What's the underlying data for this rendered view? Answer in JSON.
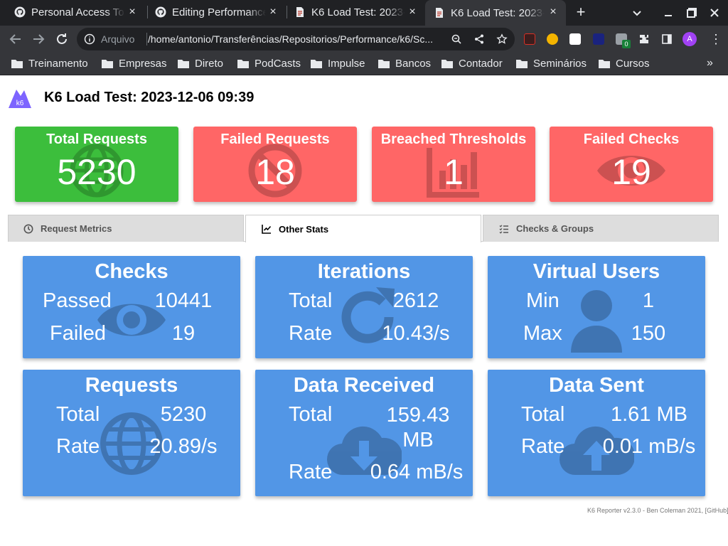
{
  "browser": {
    "tabs": [
      {
        "title": "Personal Access To",
        "favicon": "github-icon"
      },
      {
        "title": "Editing Performance",
        "favicon": "github-icon"
      },
      {
        "title": "K6 Load Test: 2023-",
        "favicon": "document-icon"
      },
      {
        "title": "K6 Load Test: 2023-",
        "favicon": "document-icon",
        "active": true
      }
    ],
    "address": {
      "scheme_label": "Arquivo",
      "url": "/home/antonio/Transferências/Repositorios/Performance/k6/Sc..."
    },
    "avatar_letter": "A",
    "extension_badge": "0",
    "bookmarks": [
      "Treinamento",
      "Empresas",
      "Direto",
      "PodCasts",
      "Impulse",
      "Bancos",
      "Contador",
      "Seminários",
      "Cursos"
    ],
    "bookmarks_more": "»"
  },
  "report": {
    "logo_text": "k6",
    "title": "K6 Load Test: 2023-12-06 09:39",
    "stat_boxes": [
      {
        "title": "Total Requests",
        "value": "5230",
        "color": "#3cbe3c",
        "icon": "globe-icon"
      },
      {
        "title": "Failed Requests",
        "value": "18",
        "color": "#ff6666",
        "icon": "ban-icon"
      },
      {
        "title": "Breached Thresholds",
        "value": "1",
        "color": "#ff6666",
        "icon": "chart-bars-icon"
      },
      {
        "title": "Failed Checks",
        "value": "19",
        "color": "#ff6666",
        "icon": "eye-icon"
      }
    ],
    "tabs": [
      {
        "label": "Request Metrics",
        "icon": "clock-icon"
      },
      {
        "label": "Other Stats",
        "icon": "chart-line-icon",
        "active": true
      },
      {
        "label": "Checks & Groups",
        "icon": "list-check-icon"
      }
    ],
    "cards": {
      "checks": {
        "title": "Checks",
        "rows": [
          {
            "label": "Passed",
            "value": "10441"
          },
          {
            "label": "Failed",
            "value": "19"
          }
        ],
        "icon": "eye-icon"
      },
      "iterations": {
        "title": "Iterations",
        "rows": [
          {
            "label": "Total",
            "value": "2612"
          },
          {
            "label": "Rate",
            "value": "10.43/s"
          }
        ],
        "icon": "redo-icon"
      },
      "virtual_users": {
        "title": "Virtual Users",
        "rows": [
          {
            "label": "Min",
            "value": "1"
          },
          {
            "label": "Max",
            "value": "150"
          }
        ],
        "icon": "user-icon"
      },
      "requests": {
        "title": "Requests",
        "rows": [
          {
            "label": "Total",
            "value": "5230"
          },
          {
            "label": "Rate",
            "value": "20.89/s"
          }
        ],
        "icon": "globe-icon"
      },
      "data_received": {
        "title": "Data Received",
        "rows": [
          {
            "label": "Total",
            "value": "159.43 MB"
          },
          {
            "label": "Rate",
            "value": "0.64 mB/s"
          }
        ],
        "icon": "cloud-download-icon"
      },
      "data_sent": {
        "title": "Data Sent",
        "rows": [
          {
            "label": "Total",
            "value": "1.61 MB"
          },
          {
            "label": "Rate",
            "value": "0.01 mB/s"
          }
        ],
        "icon": "cloud-upload-icon"
      }
    },
    "footer": "K6 Reporter v2.3.0 - Ben Coleman 2021, [GitHub]",
    "colors": {
      "card": "#5296e6",
      "success": "#3cbe3c",
      "failure": "#ff6666",
      "accent": "#7d64ff"
    }
  }
}
